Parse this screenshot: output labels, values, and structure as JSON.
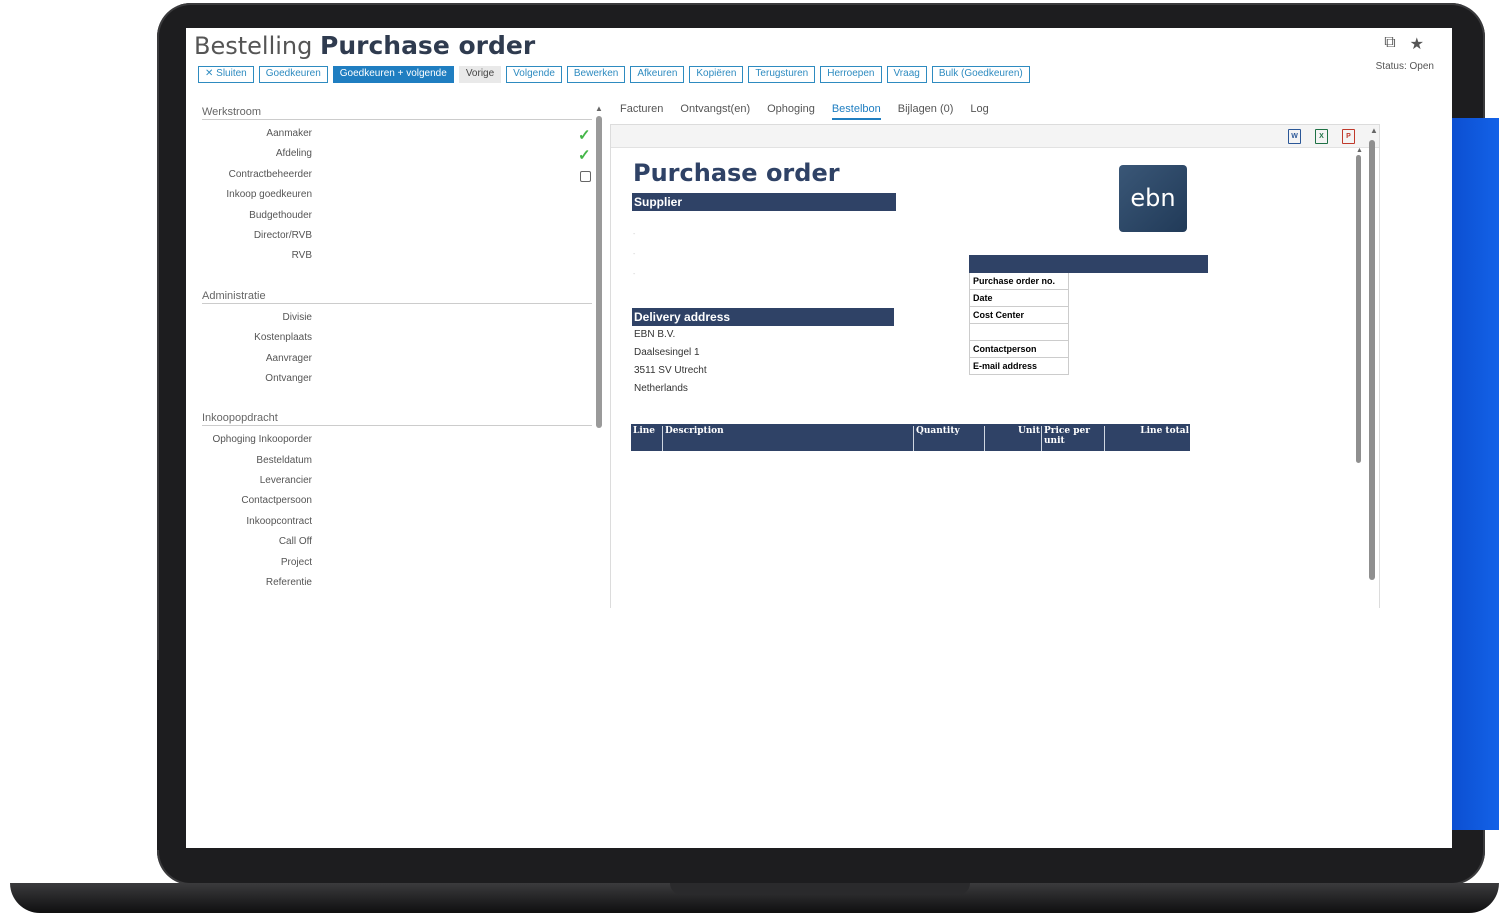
{
  "header": {
    "prefix": "Bestelling",
    "title": "Purchase order",
    "status": "Status: Open",
    "icons": [
      "window-icon",
      "star-icon"
    ]
  },
  "toolbar": {
    "buttons": [
      {
        "label": "✕ Sluiten",
        "style": "outline"
      },
      {
        "label": "Goedkeuren",
        "style": "outline"
      },
      {
        "label": "Goedkeuren + volgende",
        "style": "primary"
      },
      {
        "label": "Vorige",
        "style": "grey"
      },
      {
        "label": "Volgende",
        "style": "outline"
      },
      {
        "label": "Bewerken",
        "style": "outline"
      },
      {
        "label": "Afkeuren",
        "style": "outline"
      },
      {
        "label": "Kopiëren",
        "style": "outline"
      },
      {
        "label": "Terugsturen",
        "style": "outline"
      },
      {
        "label": "Herroepen",
        "style": "outline"
      },
      {
        "label": "Vraag",
        "style": "outline"
      },
      {
        "label": "Bulk (Goedkeuren)",
        "style": "outline"
      }
    ]
  },
  "workflow": {
    "title": "Werkstroom",
    "rows": [
      {
        "label": "Aanmaker",
        "state": "checked"
      },
      {
        "label": "Afdeling",
        "state": "checked"
      },
      {
        "label": "Contractbeheerder",
        "state": "unchecked"
      },
      {
        "label": "Inkoop goedkeuren",
        "state": "none"
      },
      {
        "label": "Budgethouder",
        "state": "none"
      },
      {
        "label": "Director/RVB",
        "state": "none"
      },
      {
        "label": "RVB",
        "state": "none"
      }
    ]
  },
  "administratie": {
    "title": "Administratie",
    "rows": [
      "Divisie",
      "Kostenplaats",
      "Aanvrager",
      "Ontvanger"
    ]
  },
  "inkoopopdracht": {
    "title": "Inkoopopdracht",
    "rows": [
      "Ophoging Inkooporder",
      "Besteldatum",
      "Leverancier",
      "Contactpersoon",
      "Inkoopcontract",
      "Call Off",
      "Project",
      "Referentie"
    ]
  },
  "tabs": [
    {
      "label": "Facturen",
      "active": false
    },
    {
      "label": "Ontvangst(en)",
      "active": false
    },
    {
      "label": "Ophoging",
      "active": false
    },
    {
      "label": "Bestelbon",
      "active": true
    },
    {
      "label": "Bijlagen (0)",
      "active": false
    },
    {
      "label": "Log",
      "active": false
    }
  ],
  "document": {
    "title": "Purchase order",
    "logo_text": "ebn",
    "supplier_heading": "Supplier",
    "delivery_heading": "Delivery address",
    "delivery_lines": [
      "EBN B.V.",
      "Daalsesingel 1",
      "3511 SV Utrecht",
      "Netherlands"
    ],
    "info_rows": [
      "Purchase order no.",
      "Date",
      "Cost Center",
      "",
      "Contactperson",
      "E-mail address"
    ],
    "line_columns": [
      "Line",
      "Description",
      "Quantity",
      "Unit",
      "Price per unit",
      "Line total"
    ],
    "export_icons": [
      "word-icon",
      "excel-icon",
      "pdf-icon"
    ]
  },
  "colors": {
    "accent": "#1f7ec1",
    "doc_navy": "#2f4266",
    "check_green": "#45b649"
  }
}
